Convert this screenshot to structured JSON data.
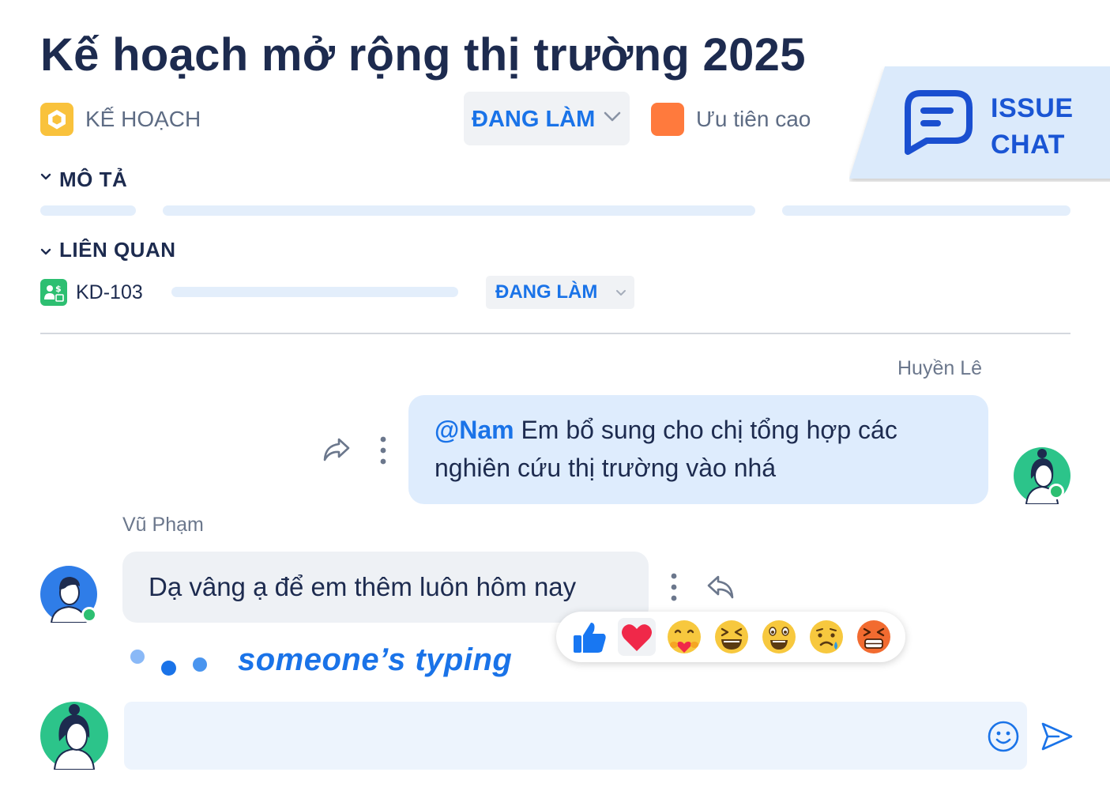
{
  "issue": {
    "title": "Kế hoạch mở rộng thị trường 2025",
    "type_label": "KẾ HOẠCH",
    "status_label": "ĐANG LÀM",
    "priority_label": "Ưu tiên cao",
    "colors": {
      "type": "#f9c23c",
      "priority": "#ff7a3d",
      "status_text": "#1a73e8"
    }
  },
  "banner": {
    "line1": "ISSUE",
    "line2": "CHAT"
  },
  "sections": {
    "description_title": "MÔ TẢ",
    "related_title": "LIÊN QUAN",
    "related_item": {
      "key": "KD-103",
      "status_label": "ĐANG LÀM"
    }
  },
  "chat": {
    "messages": [
      {
        "author": "Huyền Lê",
        "mention": "@Nam",
        "line1": " Em bổ sung cho chị tổng hợp các",
        "line2": "nghiên cứu thị trường vào nhá"
      },
      {
        "author": "Vũ Phạm",
        "text": "Dạ vâng ạ để em thêm luôn hôm nay"
      }
    ],
    "reactions": [
      "thumbs-up",
      "heart",
      "hug",
      "laugh",
      "wow",
      "sad",
      "angry"
    ],
    "typing_text": "someone’s typing"
  },
  "composer": {
    "value": ""
  }
}
